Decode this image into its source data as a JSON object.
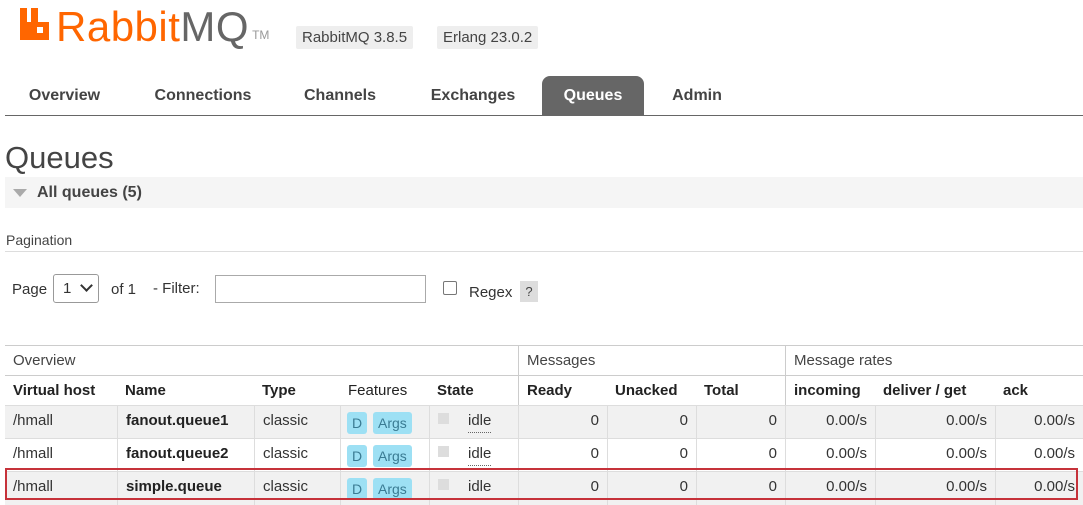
{
  "header": {
    "logo_rabbit": "Rabbit",
    "logo_mq": "MQ",
    "logo_tm": "TM",
    "version": "RabbitMQ 3.8.5",
    "erlang": "Erlang 23.0.2"
  },
  "tabs": [
    {
      "label": "Overview"
    },
    {
      "label": "Connections"
    },
    {
      "label": "Channels"
    },
    {
      "label": "Exchanges"
    },
    {
      "label": "Queues",
      "active": true
    },
    {
      "label": "Admin"
    }
  ],
  "page": {
    "title": "Queues",
    "section_label": "All queues (5)",
    "pagination_label": "Pagination"
  },
  "filter": {
    "page_label": "Page",
    "page_value": "1",
    "of_label": "of 1",
    "filter_label": "- Filter:",
    "filter_value": "",
    "regex_label": "Regex",
    "help": "?"
  },
  "table": {
    "groups": [
      "Overview",
      "Messages",
      "Message rates"
    ],
    "columns": [
      "Virtual host",
      "Name",
      "Type",
      "Features",
      "State",
      "Ready",
      "Unacked",
      "Total",
      "incoming",
      "deliver / get",
      "ack"
    ],
    "rows": [
      {
        "vhost": "/hmall",
        "name": "fanout.queue1",
        "type": "classic",
        "feat_d": "D",
        "feat_args": "Args",
        "state": "idle",
        "ready": "0",
        "unacked": "0",
        "total": "0",
        "incoming": "0.00/s",
        "deliver": "0.00/s",
        "ack": "0.00/s"
      },
      {
        "vhost": "/hmall",
        "name": "fanout.queue2",
        "type": "classic",
        "feat_d": "D",
        "feat_args": "Args",
        "state": "idle",
        "ready": "0",
        "unacked": "0",
        "total": "0",
        "incoming": "0.00/s",
        "deliver": "0.00/s",
        "ack": "0.00/s"
      },
      {
        "vhost": "/hmall",
        "name": "simple.queue",
        "type": "classic",
        "feat_d": "D",
        "feat_args": "Args",
        "state": "idle",
        "ready": "0",
        "unacked": "0",
        "total": "0",
        "incoming": "0.00/s",
        "deliver": "0.00/s",
        "ack": "0.00/s"
      }
    ]
  },
  "colors": {
    "brand_orange": "#ff6600",
    "active_tab": "#666666",
    "feature_badge": "#9de0f4",
    "highlight": "#c6323a"
  }
}
